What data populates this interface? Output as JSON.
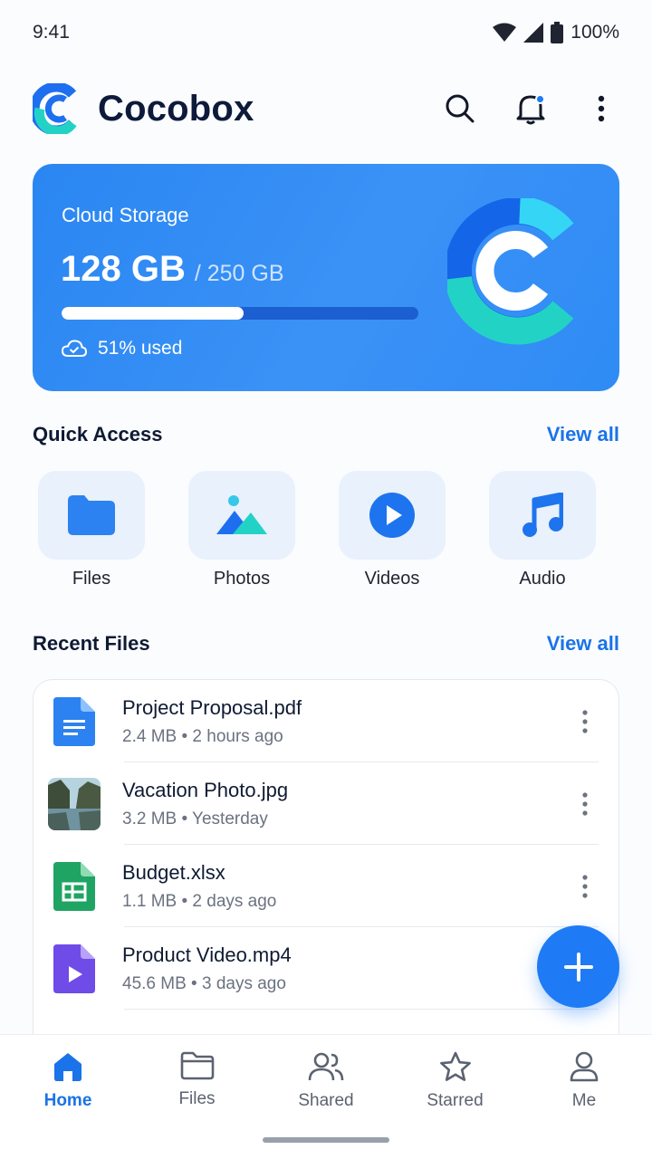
{
  "status_bar": {
    "time": "9:41",
    "battery": "100%"
  },
  "header": {
    "app_name": "Cocobox"
  },
  "storage": {
    "title": "Cloud Storage",
    "used": "128 GB",
    "total": "/ 250 GB",
    "percent_used": 51,
    "status_text": "51% used",
    "accent": "#2a86f2"
  },
  "quick_access": {
    "title": "Quick Access",
    "view_all": "View all",
    "items": [
      {
        "label": "Files",
        "icon": "folder-icon"
      },
      {
        "label": "Photos",
        "icon": "image-icon"
      },
      {
        "label": "Videos",
        "icon": "play-icon"
      },
      {
        "label": "Audio",
        "icon": "music-icon"
      }
    ]
  },
  "recent_files": {
    "title": "Recent Files",
    "view_all": "View all",
    "items": [
      {
        "name": "Project Proposal.pdf",
        "meta": "2.4 MB • 2 hours ago",
        "icon": "document-icon"
      },
      {
        "name": "Vacation Photo.jpg",
        "meta": "3.2 MB • Yesterday",
        "icon": "photo-thumbnail"
      },
      {
        "name": "Budget.xlsx",
        "meta": "1.1 MB • 2 days ago",
        "icon": "spreadsheet-icon"
      },
      {
        "name": "Product Video.mp4",
        "meta": "45.6 MB • 3 days ago",
        "icon": "video-file-icon"
      }
    ]
  },
  "bottom_nav": {
    "items": [
      {
        "label": "Home",
        "icon": "home-icon",
        "active": true
      },
      {
        "label": "Files",
        "icon": "folder-outline-icon",
        "active": false
      },
      {
        "label": "Shared",
        "icon": "people-icon",
        "active": false
      },
      {
        "label": "Starred",
        "icon": "star-icon",
        "active": false
      },
      {
        "label": "Me",
        "icon": "person-icon",
        "active": false
      }
    ]
  }
}
